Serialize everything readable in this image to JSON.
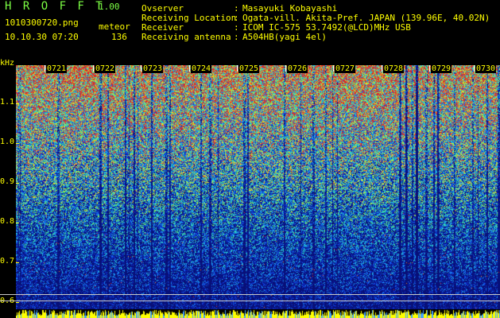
{
  "app": {
    "title": "H R O F F T",
    "version": "1.00",
    "filename": "1010300720.png",
    "datetime": "10.10.30 07:20",
    "type_label": "meteor",
    "count": "136"
  },
  "info": [
    {
      "label": "Ovserver",
      "value": "Masayuki Kobayashi"
    },
    {
      "label": "Receiving Location",
      "value": "Ogata-vill. Akita-Pref. JAPAN (139.96E, 40.02N)"
    },
    {
      "label": "Receiver",
      "value": "ICOM IC-575 53.7492(@LCD)MHz USB"
    },
    {
      "label": "Receiving antenna",
      "value": "A504HB(yagi 4el)"
    }
  ],
  "colon": ":",
  "yaxis": {
    "unit": "kHz",
    "ticks": [
      "1.1",
      "1.0",
      "0.9",
      "0.8",
      "0.7",
      "0.6"
    ]
  },
  "time_labels": [
    "0721",
    "0722",
    "0723",
    "0724",
    "0725",
    "0726",
    "0727",
    "0728",
    "0729",
    "0730"
  ],
  "colors": {
    "text": "#ffff00",
    "title": "#7cff44",
    "background": "#000000",
    "spectrum_base": "#0a1a8a"
  }
}
